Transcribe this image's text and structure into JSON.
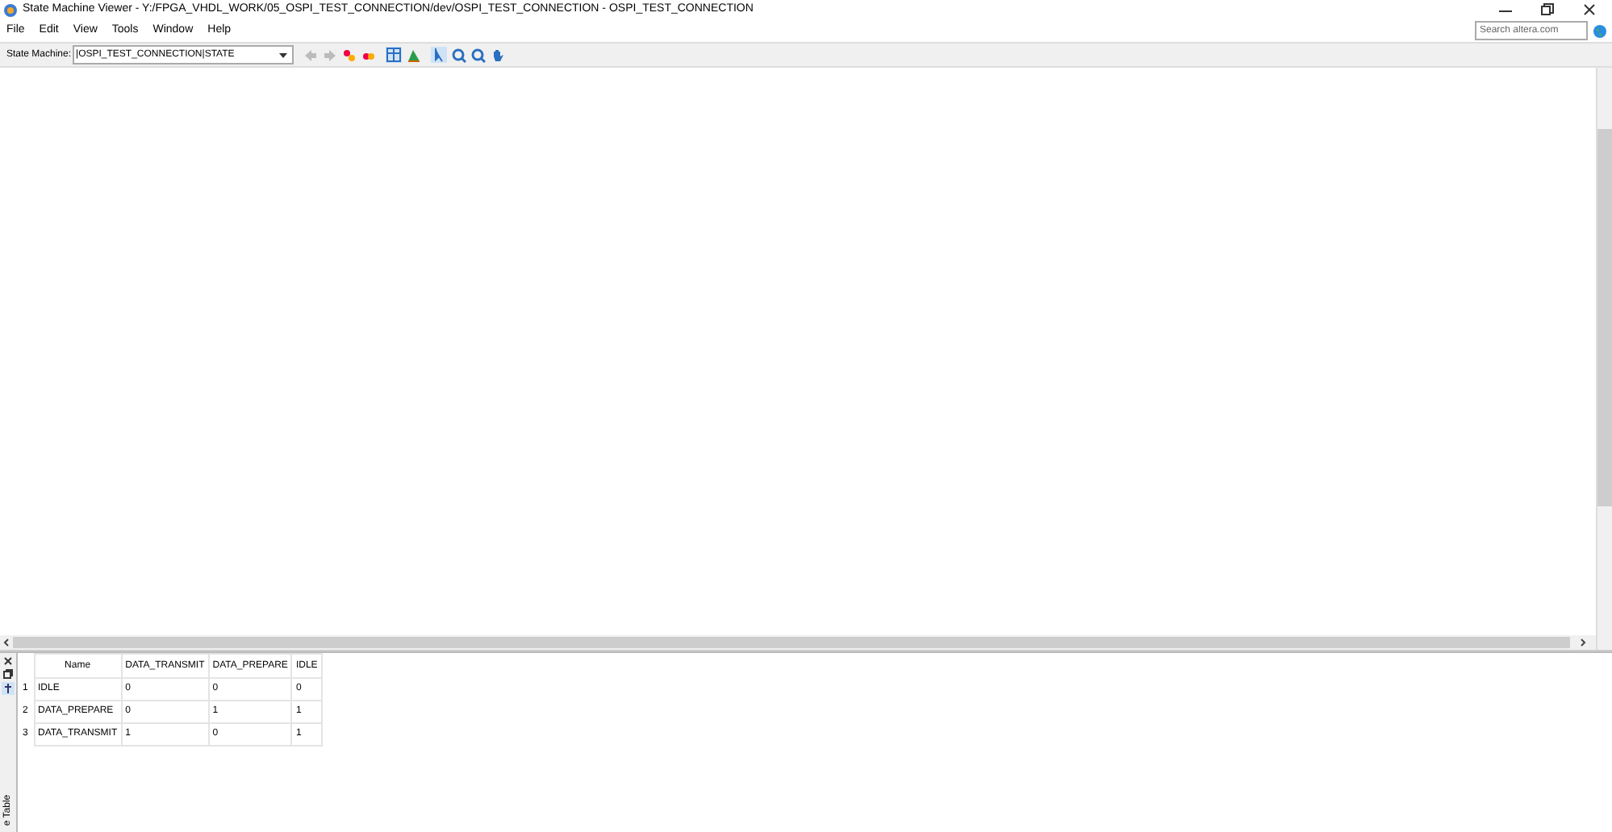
{
  "window": {
    "title": "State Machine Viewer - Y:/FPGA_VHDL_WORK/05_OSPI_TEST_CONNECTION/dev/OSPI_TEST_CONNECTION - OSPI_TEST_CONNECTION"
  },
  "search": {
    "placeholder": "Search altera.com"
  },
  "menu": [
    "File",
    "Edit",
    "View",
    "Tools",
    "Window",
    "Help"
  ],
  "toolbar": {
    "label": "State Machine:",
    "value": "|OSPI_TEST_CONNECTION|STATE"
  },
  "panel": {
    "tab_label": "e Table"
  },
  "table": {
    "columns": [
      "Name",
      "DATA_TRANSMIT",
      "DATA_PREPARE",
      "IDLE"
    ],
    "rows": [
      {
        "index": "1",
        "cells": [
          "IDLE",
          "0",
          "0",
          "0"
        ]
      },
      {
        "index": "2",
        "cells": [
          "DATA_PREPARE",
          "0",
          "1",
          "1"
        ]
      },
      {
        "index": "3",
        "cells": [
          "DATA_TRANSMIT",
          "1",
          "0",
          "1"
        ]
      }
    ]
  }
}
